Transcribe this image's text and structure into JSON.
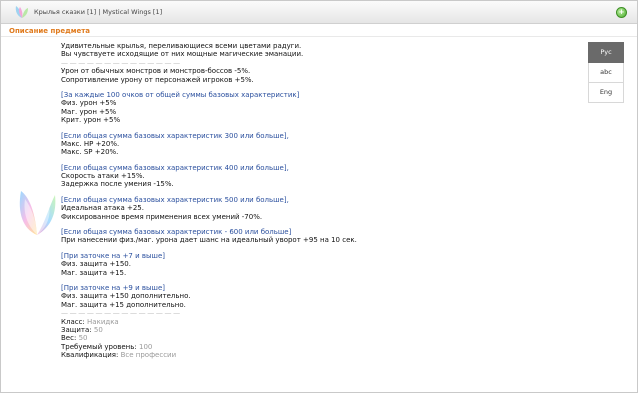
{
  "window": {
    "title": "Крылья сказки [1] | Mystical Wings [1]"
  },
  "section": {
    "label": "Описание предмета"
  },
  "description": {
    "intro": [
      "Удивительные крылья, переливающиеся всеми цветами радуги.",
      "Вы чувствуете исходящие от них мощные магические эманации."
    ],
    "separator": "— — — — — — — — — — — — — —",
    "base_effects": [
      "Урон от обычных монстров и монстров-боссов -5%.",
      "Сопротивление урону от персонажей игроков +5%."
    ],
    "blocks": [
      {
        "header": "[За каждые 100 очков от общей суммы базовых характеристик]",
        "lines": [
          "Физ. урон +5%",
          "Маг. урон +5%",
          "Крит. урон +5%"
        ]
      },
      {
        "header": "[Если общая сумма базовых характеристик 300 или больше],",
        "lines": [
          "Макс. HP +20%.",
          "Макс. SP +20%."
        ]
      },
      {
        "header": "[Если общая сумма базовых характеристик 400 или больше],",
        "lines": [
          "Скорость атаки +15%.",
          "Задержка после умения -15%."
        ]
      },
      {
        "header": "[Если общая сумма базовых характеристик 500 или больше],",
        "lines": [
          "Идеальная атака +25.",
          "Фиксированное время применения всех умений -70%."
        ]
      },
      {
        "header": "[Если общая сумма базовых характеристик - 600 или больше]",
        "lines": [
          "При нанесении физ./маг. урона дает шанс на идеальный уворот +95 на 10 сек."
        ]
      },
      {
        "header": "[При заточке на +7 и выше]",
        "lines": [
          "Физ. защита +150.",
          "Маг. защита +15."
        ]
      },
      {
        "header": "[При заточке на +9 и выше]",
        "lines": [
          "Физ. защита +150 дополнительно.",
          "Маг. защита +15 дополнительно."
        ]
      }
    ],
    "properties": [
      {
        "label": "Класс:",
        "value": "Накидка"
      },
      {
        "label": "Защита:",
        "value": "50"
      },
      {
        "label": "Вес:",
        "value": "50"
      },
      {
        "label": "Требуемый уровень:",
        "value": "100"
      },
      {
        "label": "Квалификация:",
        "value": "Все профессии"
      }
    ]
  },
  "languages": [
    "Рус",
    "abc",
    "Eng"
  ],
  "icons": {
    "title": "wings-icon",
    "item": "wings-item-icon",
    "close": "close-icon"
  },
  "colors": {
    "section_label": "#e07b1e",
    "header": "#2a4f9e",
    "value": "#9a9a9a",
    "active_lang": "#6a6a6a"
  }
}
